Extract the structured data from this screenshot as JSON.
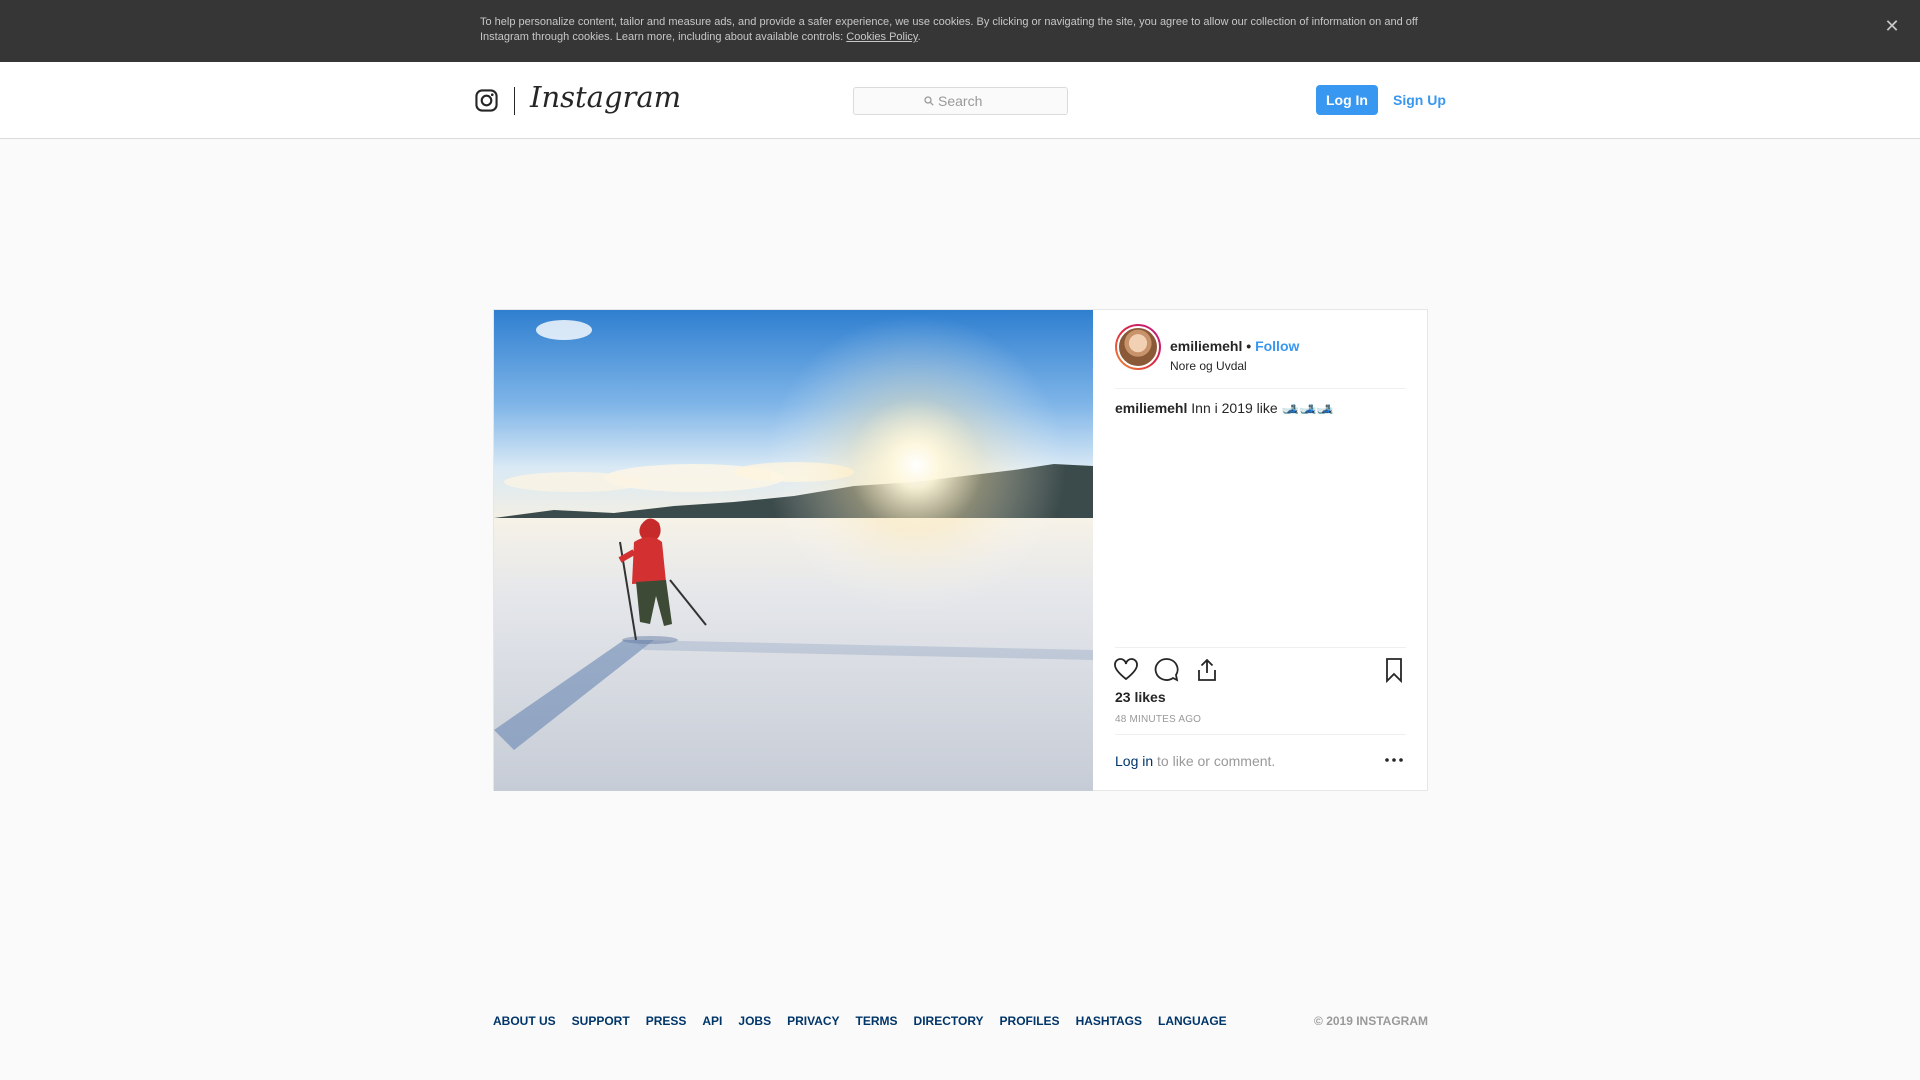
{
  "cookie_banner": {
    "text": "To help personalize content, tailor and measure ads, and provide a safer experience, we use cookies. By clicking or navigating the site, you agree to allow our collection of information on and off Instagram through cookies. Learn more, including about available controls: ",
    "link": "Cookies Policy",
    "suffix": ".",
    "close_icon": "close-icon"
  },
  "header": {
    "logo_text": "Instagram",
    "search_placeholder": "Search",
    "login_label": "Log In",
    "signup_label": "Sign Up",
    "accent_color": "#3897f0"
  },
  "post": {
    "username": "emiliemehl",
    "separator": "•",
    "follow_label": "Follow",
    "location": "Nore og Uvdal",
    "caption_user": "emiliemehl",
    "caption_text": "Inn i 2019 like 🎿🎿🎿",
    "likes": "23 likes",
    "timestamp": "48 MINUTES AGO",
    "login_link": "Log in",
    "comment_prompt": " to like or comment."
  },
  "footer": {
    "links": [
      "ABOUT US",
      "SUPPORT",
      "PRESS",
      "API",
      "JOBS",
      "PRIVACY",
      "TERMS",
      "DIRECTORY",
      "PROFILES",
      "HASHTAGS",
      "LANGUAGE"
    ],
    "copyright": "© 2019 INSTAGRAM"
  }
}
